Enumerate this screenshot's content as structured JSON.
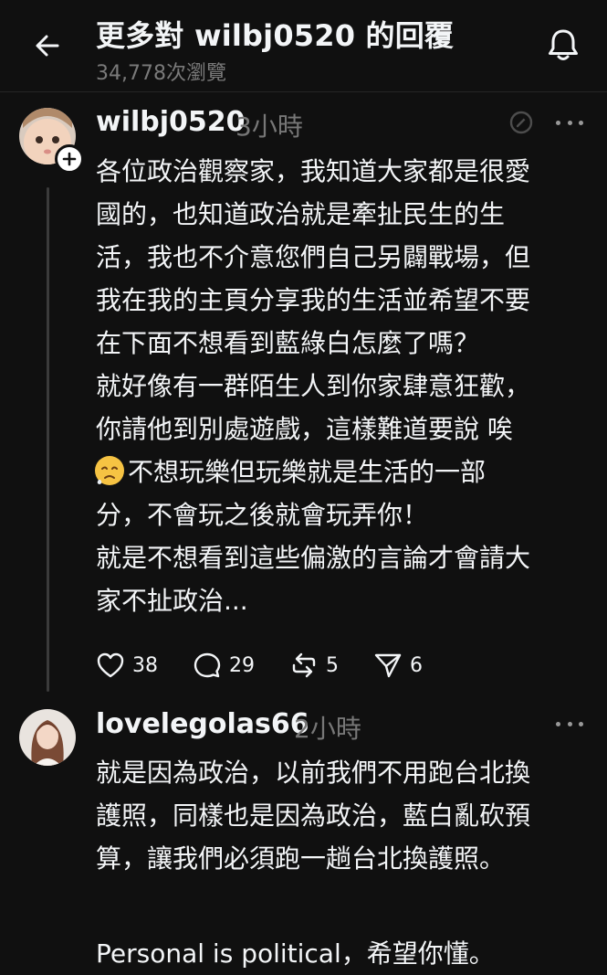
{
  "header": {
    "title": "更多對 wilbj0520 的回覆",
    "views": "34,778次瀏覽"
  },
  "post1": {
    "username": "wilbj0520",
    "time": "3小時",
    "lines": [
      "各位政治觀察家，我知道大家都是很愛",
      "國的，也知道政治就是牽扯民生的生",
      "活，我也不介意您們自己另闢戰場，但",
      "我在我的主頁分享我的生活並希望不要",
      "在下面不想看到藍綠白怎麼了嗎？",
      "就好像有一群陌生人到你家肆意狂歡，",
      "你請他到別處遊戲，這樣難道要說  唉",
      "不想玩樂但玩樂就是生活的一部",
      "分，不會玩之後就會玩弄你！",
      "就是不想看到這些偏激的言論才會請大",
      "家不扯政治..."
    ],
    "likes": "38",
    "comments": "29",
    "reposts": "5",
    "shares": "6"
  },
  "post2": {
    "username": "lovelegolas66",
    "time": "2小時",
    "lines": [
      "就是因為政治，以前我們不用跑台北換",
      "護照，同樣也是因為政治，藍白亂砍預",
      "算，讓我們必須跑一趟台北換護照。",
      "",
      "Personal is political，希望你懂。"
    ]
  }
}
